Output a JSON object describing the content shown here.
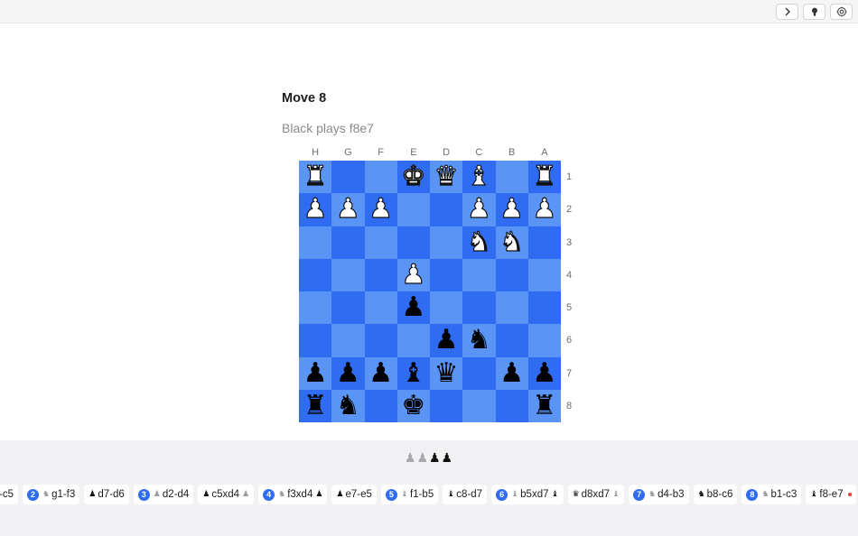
{
  "toolbar": {
    "buttons": [
      {
        "name": "next-icon",
        "glyph": "chevron-right"
      },
      {
        "name": "hint-icon",
        "glyph": "lightbulb"
      },
      {
        "name": "settings-icon",
        "glyph": "gear"
      }
    ]
  },
  "move": {
    "title": "Move 8",
    "subtitle": "Black plays f8e7"
  },
  "board": {
    "files": [
      "H",
      "G",
      "F",
      "E",
      "D",
      "C",
      "B",
      "A"
    ],
    "ranks": [
      "1",
      "2",
      "3",
      "4",
      "5",
      "6",
      "7",
      "8"
    ],
    "colors": {
      "light": "#5a95f5",
      "dark": "#2f6cf2"
    },
    "rows": [
      [
        "wR",
        "",
        "",
        "wK",
        "wQ",
        "wB",
        "",
        "wR"
      ],
      [
        "wP",
        "wP",
        "wP",
        "",
        "",
        "wP",
        "wP",
        "wP"
      ],
      [
        "",
        "",
        "",
        "",
        "",
        "wN",
        "wN",
        ""
      ],
      [
        "",
        "",
        "",
        "wP",
        "",
        "",
        "",
        ""
      ],
      [
        "",
        "",
        "",
        "bP",
        "",
        "",
        "",
        ""
      ],
      [
        "",
        "",
        "",
        "",
        "bP",
        "bN",
        "",
        ""
      ],
      [
        "bP",
        "bP",
        "bP",
        "bB",
        "bQ",
        "",
        "bP",
        "bP"
      ],
      [
        "bR",
        "bN",
        "",
        "bK",
        "",
        "",
        "",
        "bR"
      ]
    ]
  },
  "captured": {
    "grey": "♟♟",
    "black": "♟♟"
  },
  "history": [
    {
      "num": "",
      "pre": "",
      "text": "-c5",
      "post": ""
    },
    {
      "num": "2",
      "pre": "♞",
      "preColor": "grey",
      "text": "g1-f3",
      "post": ""
    },
    {
      "num": "",
      "pre": "♟",
      "preColor": "black",
      "text": "d7-d6",
      "post": ""
    },
    {
      "num": "3",
      "pre": "♟",
      "preColor": "grey",
      "text": "d2-d4",
      "post": ""
    },
    {
      "num": "",
      "pre": "♟",
      "preColor": "black",
      "text": "c5xd4",
      "post": "♟",
      "postColor": "grey"
    },
    {
      "num": "4",
      "pre": "♞",
      "preColor": "grey",
      "text": "f3xd4",
      "post": "♟",
      "postColor": "black"
    },
    {
      "num": "",
      "pre": "♟",
      "preColor": "black",
      "text": "e7-e5",
      "post": ""
    },
    {
      "num": "5",
      "pre": "♝",
      "preColor": "grey",
      "text": "f1-b5",
      "post": ""
    },
    {
      "num": "",
      "pre": "♝",
      "preColor": "black",
      "text": "c8-d7",
      "post": ""
    },
    {
      "num": "6",
      "pre": "♝",
      "preColor": "grey",
      "text": "b5xd7",
      "post": "♝",
      "postColor": "black"
    },
    {
      "num": "",
      "pre": "♛",
      "preColor": "black",
      "text": "d8xd7",
      "post": "♝",
      "postColor": "grey"
    },
    {
      "num": "7",
      "pre": "♞",
      "preColor": "grey",
      "text": "d4-b3",
      "post": ""
    },
    {
      "num": "",
      "pre": "♞",
      "preColor": "black",
      "text": "b8-c6",
      "post": ""
    },
    {
      "num": "8",
      "pre": "♞",
      "preColor": "grey",
      "text": "b1-c3",
      "post": ""
    },
    {
      "num": "",
      "pre": "♝",
      "preColor": "black",
      "text": "f8-e7",
      "post": "",
      "current": true
    }
  ]
}
